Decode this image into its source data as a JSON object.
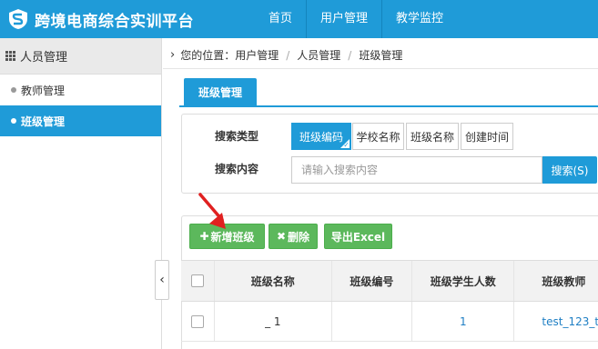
{
  "app": {
    "title": "跨境电商综合实训平台",
    "accent_color": "#1f9bd8",
    "logo_icon": "s-shield-logo-icon"
  },
  "topnav": {
    "items": [
      "首页",
      "用户管理",
      "教学监控"
    ]
  },
  "sidebar": {
    "group_label": "人员管理",
    "group_icon": "grid-icon",
    "items": [
      {
        "label": "教师管理",
        "active": false
      },
      {
        "label": "班级管理",
        "active": true
      }
    ],
    "collapse_icon": "chevron-left-icon",
    "collapse_glyph": "‹"
  },
  "breadcrumb": {
    "prefix": "您的位置：",
    "items": [
      "用户管理",
      "人员管理",
      "班级管理"
    ],
    "separator": "/"
  },
  "tab": {
    "label": "班级管理"
  },
  "search": {
    "type_label": "搜索类型",
    "content_label": "搜索内容",
    "types": [
      "班级编码",
      "学校名称",
      "班级名称",
      "创建时间"
    ],
    "selected_type": "班级编码",
    "placeholder": "请输入搜索内容",
    "value": "",
    "button_label": "搜索(S)"
  },
  "actions": {
    "add_label": "新增班级",
    "delete_label": "删除",
    "export_label": "导出Excel",
    "add_icon": "plus-icon",
    "delete_icon": "x-icon",
    "button_color": "#5cb85c"
  },
  "table": {
    "columns": [
      "班级名称",
      "班级编号",
      "班级学生人数",
      "班级教师"
    ],
    "rows": [
      {
        "class_name": "_ 1",
        "class_code": "",
        "student_count": "1",
        "teacher": "test_123_t"
      }
    ]
  },
  "annotation": {
    "arrow_color": "#e02020"
  }
}
